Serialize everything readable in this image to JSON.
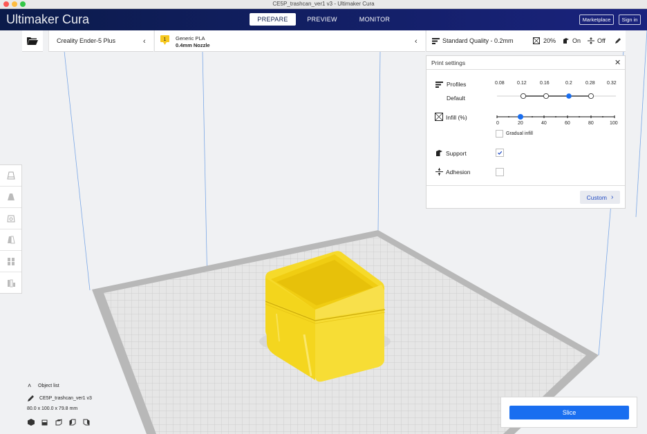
{
  "window": {
    "title": "CE5P_trashcan_ver1 v3 - Ultimaker Cura"
  },
  "brand": {
    "name_light": "Ultimaker",
    "name_bold": "Cura"
  },
  "nav": {
    "tabs": [
      {
        "label": "PREPARE",
        "active": true
      },
      {
        "label": "PREVIEW",
        "active": false
      },
      {
        "label": "MONITOR",
        "active": false
      }
    ],
    "marketplace_label": "Marketplace",
    "signin_label": "Sign in"
  },
  "stage": {
    "printer": "Creality Ender-5 Plus",
    "material_name": "Generic PLA",
    "nozzle": "0.4mm Nozzle",
    "quality": "Standard Quality - 0.2mm",
    "infill_summary": "20%",
    "support_summary": "On",
    "adhesion_summary": "Off"
  },
  "print_settings": {
    "title": "Print settings",
    "profiles_label": "Profiles",
    "profile_default_label": "Default",
    "layer_heights": [
      "0.08",
      "0.12",
      "0.16",
      "0.2",
      "0.28",
      "0.32"
    ],
    "selected_layer_height": "0.2",
    "infill_label": "Infill (%)",
    "infill_ticks": [
      "0",
      "20",
      "40",
      "60",
      "80",
      "100"
    ],
    "infill_value": 20,
    "gradual_label": "Gradual infill",
    "gradual_checked": false,
    "support_label": "Support",
    "support_checked": true,
    "adhesion_label": "Adhesion",
    "adhesion_checked": false,
    "custom_label": "Custom"
  },
  "object_list": {
    "header": "Object list",
    "item_name": "CE5P_trashcan_ver1 v3",
    "dimensions": "80.0 x 100.0 x 79.8 mm"
  },
  "slice": {
    "label": "Slice"
  },
  "colors": {
    "header_bg": "#0b1b4a",
    "accent": "#196ef0",
    "model": "#f7d923",
    "bed_grid": "#c9c9c9"
  }
}
